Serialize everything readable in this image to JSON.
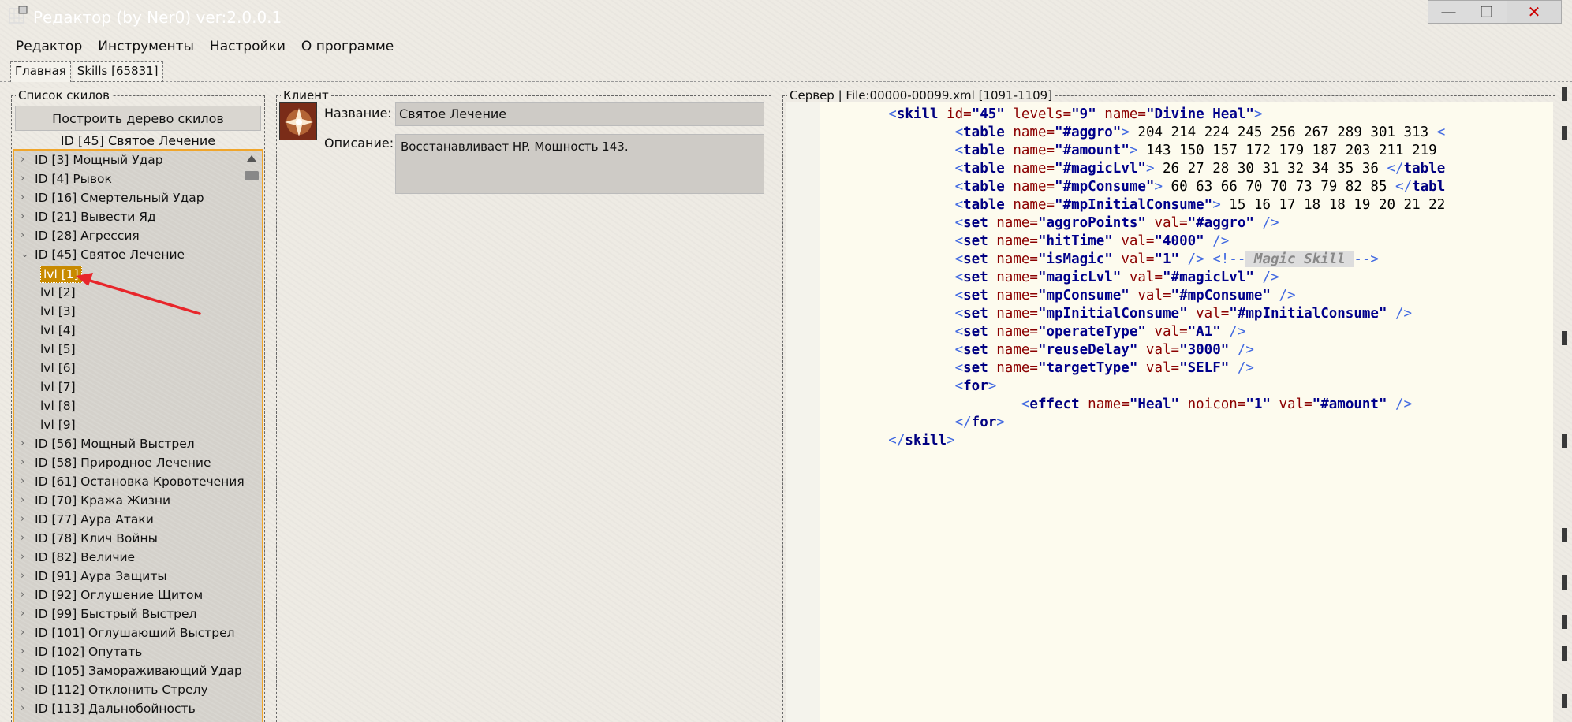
{
  "window": {
    "title": "Редактор (by Ner0) ver:2.0.0.1",
    "minimize": "—",
    "maximize": "☐",
    "close": "✕"
  },
  "menu": [
    "Редактор",
    "Инструменты",
    "Настройки",
    "О программе"
  ],
  "tabs": [
    "Главная",
    "Skills [65831]"
  ],
  "skills_panel": {
    "legend": "Список скилов",
    "build_button": "Построить дерево скилов",
    "current": "ID [45] Святое Лечение",
    "items_before": [
      "ID [3] Мощный Удар",
      "ID [4] Рывок",
      "ID [16] Смертельный Удар",
      "ID [21] Вывести Яд",
      "ID [28] Агрессия"
    ],
    "expanded_item": "ID [45] Святое Лечение",
    "levels": [
      "lvl [1]",
      "lvl [2]",
      "lvl [3]",
      "lvl [4]",
      "lvl [5]",
      "lvl [6]",
      "lvl [7]",
      "lvl [8]",
      "lvl [9]"
    ],
    "selected_level": 0,
    "items_after": [
      "ID [56] Мощный Выстрел",
      "ID [58] Природное Лечение",
      "ID [61] Остановка Кровотечения",
      "ID [70] Кража Жизни",
      "ID [77] Аура Атаки",
      "ID [78] Клич Войны",
      "ID [82] Величие",
      "ID [91] Аура Защиты",
      "ID [92] Оглушение Щитом",
      "ID [99] Быстрый Выстрел",
      "ID [101] Оглушающий Выстрел",
      "ID [102] Опутать",
      "ID [105] Замораживающий Удар",
      "ID [112] Отклонить Стрелу",
      "ID [113] Дальнобойность"
    ]
  },
  "client_panel": {
    "legend": "Клиент",
    "name_label": "Название:",
    "name_value": "Святое Лечение",
    "desc_label": "Описание:",
    "desc_value": "Восстанавливает HP. Мощность 143."
  },
  "server_panel": {
    "legend": "Сервер | File:00000-00099.xml [1091-1109]",
    "code_lines": [
      [
        {
          "s": "        "
        },
        {
          "c": "<"
        },
        {
          "t": "skill"
        },
        {
          "a": " id="
        },
        {
          "v": "\"45\""
        },
        {
          "a": " levels="
        },
        {
          "v": "\"9\""
        },
        {
          "a": " name="
        },
        {
          "v": "\"Divine Heal\""
        },
        {
          "c": ">"
        }
      ],
      [
        {
          "s": "                "
        },
        {
          "c": "<"
        },
        {
          "t": "table"
        },
        {
          "a": " name="
        },
        {
          "v": "\"#aggro\""
        },
        {
          "c": ">"
        },
        {
          "n": " 204 214 224 245 256 267 289 301 313 "
        },
        {
          "c": "<"
        }
      ],
      [
        {
          "s": "                "
        },
        {
          "c": "<"
        },
        {
          "t": "table"
        },
        {
          "a": " name="
        },
        {
          "v": "\"#amount\""
        },
        {
          "c": ">"
        },
        {
          "n": " 143 150 157 172 179 187 203 211 219 "
        }
      ],
      [
        {
          "s": "                "
        },
        {
          "c": "<"
        },
        {
          "t": "table"
        },
        {
          "a": " name="
        },
        {
          "v": "\"#magicLvl\""
        },
        {
          "c": ">"
        },
        {
          "n": " 26 27 28 30 31 32 34 35 36 "
        },
        {
          "c": "</"
        },
        {
          "t": "table"
        }
      ],
      [
        {
          "s": "                "
        },
        {
          "c": "<"
        },
        {
          "t": "table"
        },
        {
          "a": " name="
        },
        {
          "v": "\"#mpConsume\""
        },
        {
          "c": ">"
        },
        {
          "n": " 60 63 66 70 70 73 79 82 85 "
        },
        {
          "c": "</"
        },
        {
          "t": "tabl"
        }
      ],
      [
        {
          "s": "                "
        },
        {
          "c": "<"
        },
        {
          "t": "table"
        },
        {
          "a": " name="
        },
        {
          "v": "\"#mpInitialConsume\""
        },
        {
          "c": ">"
        },
        {
          "n": " 15 16 17 18 18 19 20 21 22"
        }
      ],
      [
        {
          "s": "                "
        },
        {
          "c": "<"
        },
        {
          "t": "set"
        },
        {
          "a": " name="
        },
        {
          "v": "\"aggroPoints\""
        },
        {
          "a": " val="
        },
        {
          "v": "\"#aggro\""
        },
        {
          "c": " />"
        }
      ],
      [
        {
          "s": "                "
        },
        {
          "c": "<"
        },
        {
          "t": "set"
        },
        {
          "a": " name="
        },
        {
          "v": "\"hitTime\""
        },
        {
          "a": " val="
        },
        {
          "v": "\"4000\""
        },
        {
          "c": " />"
        }
      ],
      [
        {
          "s": "                "
        },
        {
          "c": "<"
        },
        {
          "t": "set"
        },
        {
          "a": " name="
        },
        {
          "v": "\"isMagic\""
        },
        {
          "a": " val="
        },
        {
          "v": "\"1\""
        },
        {
          "c": " /> <!--"
        },
        {
          "m": " Magic Skill "
        },
        {
          "c": "-->"
        }
      ],
      [
        {
          "s": "                "
        },
        {
          "c": "<"
        },
        {
          "t": "set"
        },
        {
          "a": " name="
        },
        {
          "v": "\"magicLvl\""
        },
        {
          "a": " val="
        },
        {
          "v": "\"#magicLvl\""
        },
        {
          "c": " />"
        }
      ],
      [
        {
          "s": "                "
        },
        {
          "c": "<"
        },
        {
          "t": "set"
        },
        {
          "a": " name="
        },
        {
          "v": "\"mpConsume\""
        },
        {
          "a": " val="
        },
        {
          "v": "\"#mpConsume\""
        },
        {
          "c": " />"
        }
      ],
      [
        {
          "s": "                "
        },
        {
          "c": "<"
        },
        {
          "t": "set"
        },
        {
          "a": " name="
        },
        {
          "v": "\"mpInitialConsume\""
        },
        {
          "a": " val="
        },
        {
          "v": "\"#mpInitialConsume\""
        },
        {
          "c": " />"
        }
      ],
      [
        {
          "s": "                "
        },
        {
          "c": "<"
        },
        {
          "t": "set"
        },
        {
          "a": " name="
        },
        {
          "v": "\"operateType\""
        },
        {
          "a": " val="
        },
        {
          "v": "\"A1\""
        },
        {
          "c": " />"
        }
      ],
      [
        {
          "s": "                "
        },
        {
          "c": "<"
        },
        {
          "t": "set"
        },
        {
          "a": " name="
        },
        {
          "v": "\"reuseDelay\""
        },
        {
          "a": " val="
        },
        {
          "v": "\"3000\""
        },
        {
          "c": " />"
        }
      ],
      [
        {
          "s": "                "
        },
        {
          "c": "<"
        },
        {
          "t": "set"
        },
        {
          "a": " name="
        },
        {
          "v": "\"targetType\""
        },
        {
          "a": " val="
        },
        {
          "v": "\"SELF\""
        },
        {
          "c": " />"
        }
      ],
      [
        {
          "s": "                "
        },
        {
          "c": "<"
        },
        {
          "t": "for"
        },
        {
          "c": ">"
        }
      ],
      [
        {
          "s": "                        "
        },
        {
          "c": "<"
        },
        {
          "t": "effect"
        },
        {
          "a": " name="
        },
        {
          "v": "\"Heal\""
        },
        {
          "a": " noicon="
        },
        {
          "v": "\"1\""
        },
        {
          "a": " val="
        },
        {
          "v": "\"#amount\""
        },
        {
          "c": " />"
        }
      ],
      [
        {
          "s": "                "
        },
        {
          "c": "</"
        },
        {
          "t": "for"
        },
        {
          "c": ">"
        }
      ],
      [
        {
          "s": "        "
        },
        {
          "c": "</"
        },
        {
          "t": "skill"
        },
        {
          "c": ">"
        }
      ]
    ]
  },
  "colors": {
    "accent": "#f0a52a",
    "selection": "#c88a00",
    "titlebar": "#3e5b84",
    "arrow": "#e8262b"
  },
  "icons": {
    "app": "app-grid-icon",
    "skill": "divine-heal-skill-icon",
    "arrow": "red-arrow-annotation"
  }
}
